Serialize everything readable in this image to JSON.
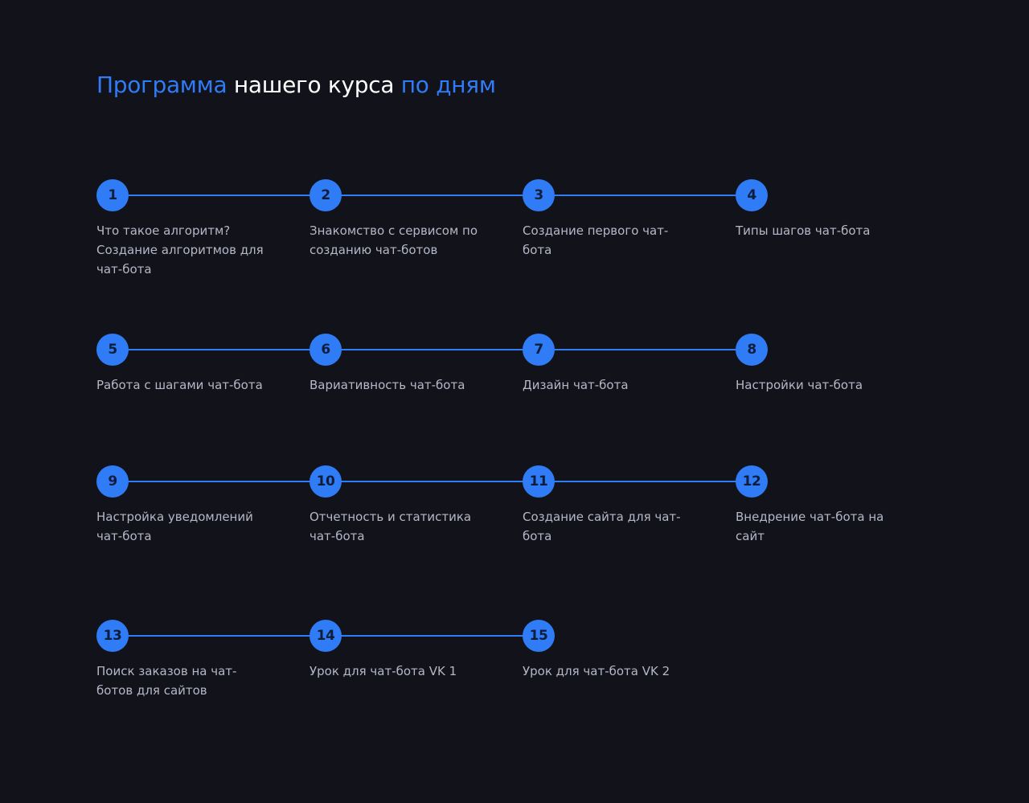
{
  "header": {
    "title_part1": "Программа",
    "title_part2": "нашего курса",
    "title_part3": "по дням"
  },
  "colors": {
    "background": "#12121b",
    "accent": "#2f7cf6",
    "text": "#b4b8c6",
    "heading": "#ffffff"
  },
  "days": [
    {
      "num": "1",
      "label": "Что такое алгоритм? Создание алгоритмов для чат-бота"
    },
    {
      "num": "2",
      "label": "Знакомство с сервисом по созданию чат-ботов"
    },
    {
      "num": "3",
      "label": "Создание первого чат-бота"
    },
    {
      "num": "4",
      "label": "Типы шагов чат-бота"
    },
    {
      "num": "5",
      "label": "Работа с шагами чат-бота"
    },
    {
      "num": "6",
      "label": "Вариативность чат-бота"
    },
    {
      "num": "7",
      "label": "Дизайн чат-бота"
    },
    {
      "num": "8",
      "label": "Настройки чат-бота"
    },
    {
      "num": "9",
      "label": "Настройка уведомлений чат-бота"
    },
    {
      "num": "10",
      "label": "Отчетность и статистика чат-бота"
    },
    {
      "num": "11",
      "label": "Создание сайта для чат-бота"
    },
    {
      "num": "12",
      "label": "Внедрение чат-бота на сайт"
    },
    {
      "num": "13",
      "label": "Поиск заказов на чат-ботов для сайтов"
    },
    {
      "num": "14",
      "label": "Урок для чат-бота VK 1"
    },
    {
      "num": "15",
      "label": "Урок для чат-бота VK 2"
    }
  ]
}
